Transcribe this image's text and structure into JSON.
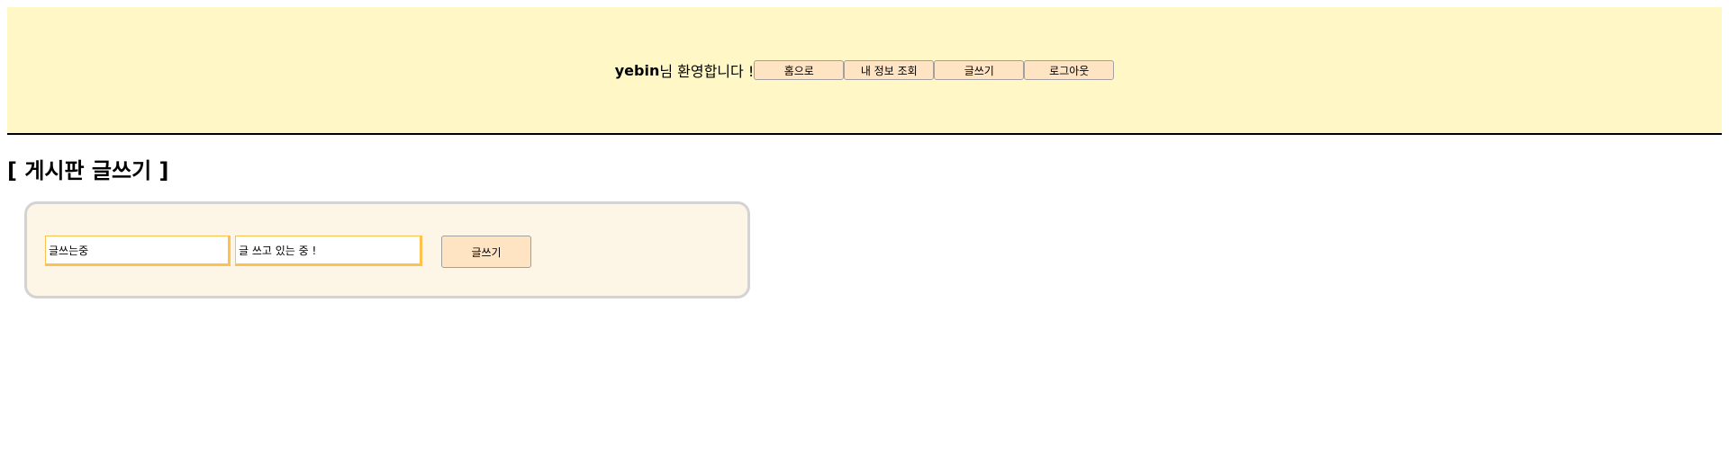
{
  "header": {
    "username": "yebin",
    "welcome_suffix": "님 환영합니다 !",
    "nav": {
      "home_label": "홈으로",
      "my_info_label": "내 정보 조회",
      "write_label": "글쓰기",
      "logout_label": "로그아웃"
    }
  },
  "page": {
    "title": "[ 게시판 글쓰기 ]"
  },
  "form": {
    "title_value": "글쓰는중",
    "content_value": "글 쓰고 있는 중 !",
    "submit_label": "글쓰기"
  },
  "colors": {
    "header_bg": "#fff8c6",
    "button_bg": "#ffe4c4",
    "form_bg": "#fdf5e6",
    "input_border": "#ffc14d"
  }
}
